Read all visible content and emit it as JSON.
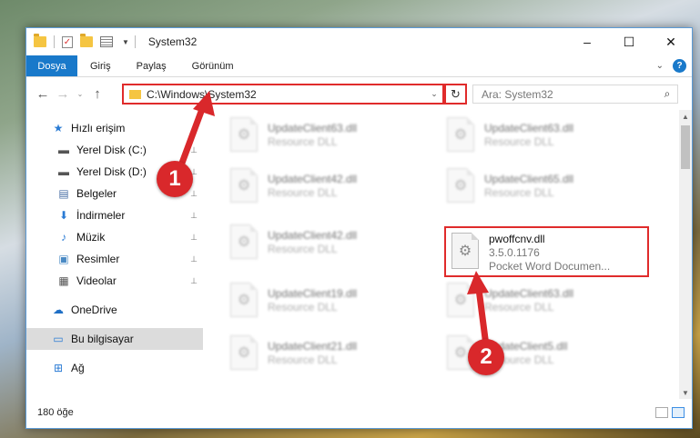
{
  "window": {
    "title": "System32",
    "controls": {
      "minimize": "–",
      "maximize": "☐",
      "close": "✕"
    }
  },
  "ribbon": {
    "tabs": [
      "Dosya",
      "Giriş",
      "Paylaş",
      "Görünüm"
    ],
    "expand": "⌄",
    "help": "?"
  },
  "nav": {
    "back": "←",
    "forward": "→",
    "recent": "⌄",
    "up": "↑",
    "address": "C:\\Windows\\System32",
    "address_dropdown": "⌄",
    "refresh": "↻",
    "search_placeholder": "Ara: System32",
    "search_icon": "⌕"
  },
  "sidebar": {
    "items": [
      {
        "label": "Hızlı erişim",
        "icon": "star-icon",
        "glyph": "★",
        "color": "#2a7bd4",
        "pinned": false
      },
      {
        "label": "Yerel Disk (C:)",
        "icon": "drive-icon",
        "glyph": "▬",
        "color": "#555555",
        "pinned": true
      },
      {
        "label": "Yerel Disk (D:)",
        "icon": "drive-icon",
        "glyph": "▬",
        "color": "#555555",
        "pinned": true
      },
      {
        "label": "Belgeler",
        "icon": "documents-icon",
        "glyph": "▤",
        "color": "#4a6fa5",
        "pinned": true
      },
      {
        "label": "İndirmeler",
        "icon": "download-icon",
        "glyph": "⬇",
        "color": "#2a7bd4",
        "pinned": true
      },
      {
        "label": "Müzik",
        "icon": "music-icon",
        "glyph": "♪",
        "color": "#2a7bd4",
        "pinned": true
      },
      {
        "label": "Resimler",
        "icon": "pictures-icon",
        "glyph": "▣",
        "color": "#4a8ac4",
        "pinned": true
      },
      {
        "label": "Videolar",
        "icon": "videos-icon",
        "glyph": "▦",
        "color": "#555555",
        "pinned": true
      },
      {
        "label": "OneDrive",
        "icon": "cloud-icon",
        "glyph": "☁",
        "color": "#1f6fc5",
        "pinned": false
      },
      {
        "label": "Bu bilgisayar",
        "icon": "computer-icon",
        "glyph": "▭",
        "color": "#2a7bd4",
        "pinned": false,
        "selected": true
      },
      {
        "label": "Ağ",
        "icon": "network-icon",
        "glyph": "⊞",
        "color": "#2a7bd4",
        "pinned": false
      }
    ],
    "pin_glyph": "📌"
  },
  "files": [
    {
      "name": "UpdateClient63.dll",
      "type": "Resource DLL"
    },
    {
      "name": "UpdateClient63.dll",
      "type": "Resource DLL"
    },
    {
      "name": "UpdateClient42.dll",
      "type": "Resource DLL"
    },
    {
      "name": "UpdateClient65.dll",
      "type": "Resource DLL"
    },
    {
      "name": "UpdateClient42.dll",
      "type": "Resource DLL"
    },
    {
      "name": "UpdateClient19.dll",
      "type": "Resource DLL"
    },
    {
      "name": "UpdateClient63.dll",
      "type": "Resource DLL"
    },
    {
      "name": "UpdateClient21.dll",
      "type": "Resource DLL"
    },
    {
      "name": "UpdateClient5.dll",
      "type": "Resource DLL"
    }
  ],
  "highlighted_file": {
    "name": "pwoffcnv.dll",
    "version": "3.5.0.1176",
    "description": "Pocket Word Documen..."
  },
  "status": {
    "item_count": "180 öğe"
  },
  "callouts": [
    "1",
    "2"
  ],
  "colors": {
    "accent": "#1979ca",
    "highlight": "#e02b2b",
    "callout": "#d9282b"
  }
}
